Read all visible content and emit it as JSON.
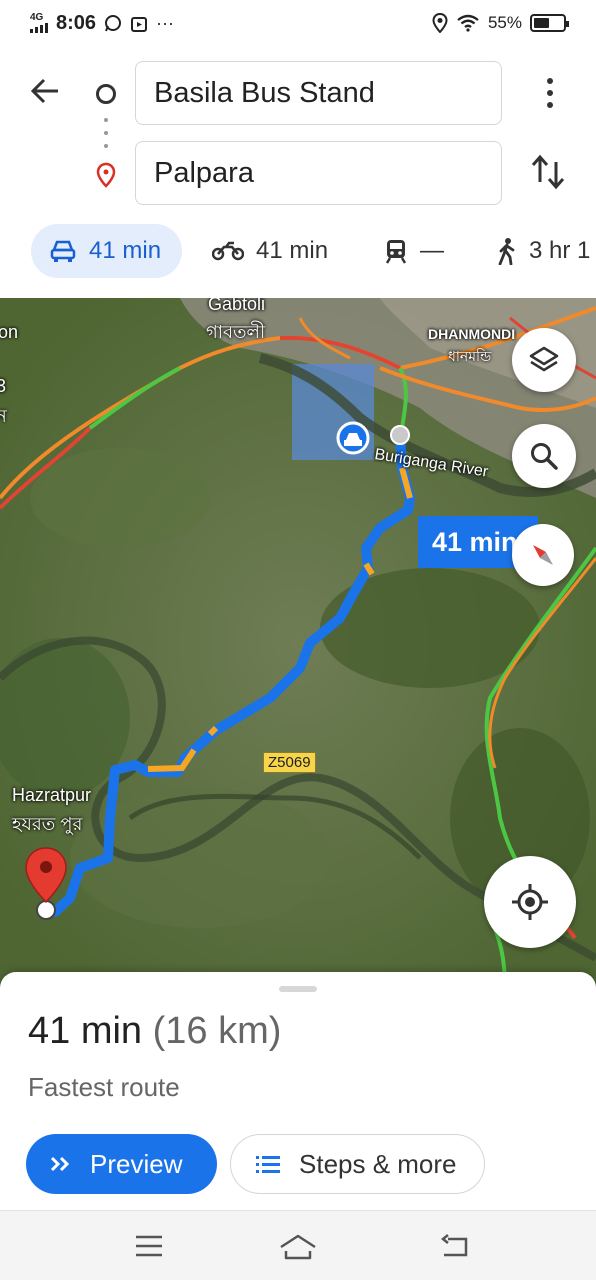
{
  "status_bar": {
    "time": "8:06",
    "network": "4G",
    "battery": "55%",
    "battery_level": 0.55,
    "more": "···"
  },
  "directions": {
    "origin": "Basila Bus Stand",
    "destination": "Palpara",
    "modes": [
      {
        "name": "drive",
        "icon": "car-icon",
        "label": "41 min",
        "active": true
      },
      {
        "name": "motorcycle",
        "icon": "motorcycle-icon",
        "label": "41 min",
        "active": false
      },
      {
        "name": "transit",
        "icon": "train-icon",
        "label": "—",
        "active": false
      },
      {
        "name": "walk",
        "icon": "walk-icon",
        "label": "3 hr 1",
        "active": false
      }
    ]
  },
  "map": {
    "labels": {
      "gabtoli_en": "Gabtoli",
      "gabtoli_bn": "গাবতলী",
      "dhanmondi_en": "DHANMONDI",
      "dhanmondi_bn": "ধানমন্ডি",
      "river": "Buriganga River",
      "hazratpur_en": "Hazratpur",
      "hazratpur_bn": "হযরত পুর",
      "left_edge_1": "on",
      "left_edge_2": "3",
      "left_edge_3": "ন"
    },
    "route_duration": "41 min",
    "road_shield": "Z5069",
    "route_color": "#1a73e8",
    "traffic_slow_color": "#f5a623"
  },
  "sheet": {
    "duration": "41 min",
    "distance": "(16 km)",
    "subtitle": "Fastest route",
    "preview_label": "Preview",
    "steps_label": "Steps & more"
  }
}
